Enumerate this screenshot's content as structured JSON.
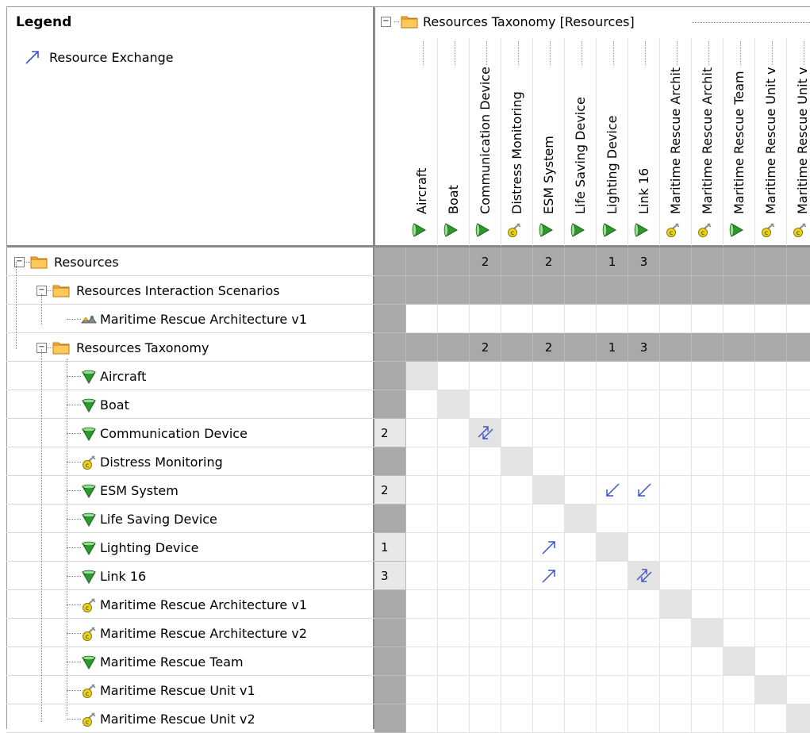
{
  "legend": {
    "title": "Legend",
    "item_label": "Resource Exchange",
    "arrow_color": "#3a55c8"
  },
  "column_group": {
    "label": "Resources Taxonomy [Resources]"
  },
  "columns": [
    {
      "label": "Aircraft",
      "icon": "resource-green-icon"
    },
    {
      "label": "Boat",
      "icon": "resource-green-icon"
    },
    {
      "label": "Communication Device",
      "icon": "resource-green-icon"
    },
    {
      "label": "Distress Monitoring",
      "icon": "capability-icon"
    },
    {
      "label": "ESM System",
      "icon": "resource-green-icon"
    },
    {
      "label": "Life Saving Device",
      "icon": "resource-green-icon"
    },
    {
      "label": "Lighting Device",
      "icon": "resource-green-icon"
    },
    {
      "label": "Link 16",
      "icon": "resource-green-icon"
    },
    {
      "label": "Maritime Rescue Archit",
      "icon": "capability-icon"
    },
    {
      "label": "Maritime Rescue Archit",
      "icon": "capability-icon"
    },
    {
      "label": "Maritime Rescue Team",
      "icon": "resource-green-icon"
    },
    {
      "label": "Maritime Rescue Unit v",
      "icon": "capability-icon"
    },
    {
      "label": "Maritime Rescue Unit v",
      "icon": "capability-icon"
    }
  ],
  "rows": [
    {
      "label": "Resources",
      "icon": "folder-icon",
      "count": ""
    },
    {
      "label": "Resources Interaction Scenarios",
      "icon": "folder-icon",
      "count": ""
    },
    {
      "label": "Maritime Rescue Architecture v1",
      "icon": "architecture-icon",
      "count": ""
    },
    {
      "label": "Resources Taxonomy",
      "icon": "folder-icon",
      "count": ""
    },
    {
      "label": "Aircraft",
      "icon": "resource-green-icon",
      "count": ""
    },
    {
      "label": "Boat",
      "icon": "resource-green-icon",
      "count": ""
    },
    {
      "label": "Communication Device",
      "icon": "resource-green-icon",
      "count": "2"
    },
    {
      "label": "Distress Monitoring",
      "icon": "capability-icon",
      "count": ""
    },
    {
      "label": "ESM System",
      "icon": "resource-green-icon",
      "count": "2"
    },
    {
      "label": "Life Saving Device",
      "icon": "resource-green-icon",
      "count": ""
    },
    {
      "label": "Lighting Device",
      "icon": "resource-green-icon",
      "count": "1"
    },
    {
      "label": "Link 16",
      "icon": "resource-green-icon",
      "count": "3"
    },
    {
      "label": "Maritime Rescue Architecture v1",
      "icon": "capability-icon",
      "count": ""
    },
    {
      "label": "Maritime Rescue Architecture v2",
      "icon": "capability-icon",
      "count": ""
    },
    {
      "label": "Maritime Rescue Team",
      "icon": "resource-green-icon",
      "count": ""
    },
    {
      "label": "Maritime Rescue Unit v1",
      "icon": "capability-icon",
      "count": ""
    },
    {
      "label": "Maritime Rescue Unit v2",
      "icon": "capability-icon",
      "count": ""
    }
  ],
  "group_totals": {
    "resources": [
      "",
      "",
      "2",
      "",
      "2",
      "",
      "1",
      "3",
      "",
      "",
      "",
      "",
      ""
    ],
    "resources_taxonomy": [
      "",
      "",
      "2",
      "",
      "2",
      "",
      "1",
      "3",
      "",
      "",
      "",
      "",
      ""
    ]
  },
  "cells": [
    {
      "row": 6,
      "col": 2,
      "arrow": "bidirectional"
    },
    {
      "row": 8,
      "col": 6,
      "arrow": "down-left"
    },
    {
      "row": 8,
      "col": 7,
      "arrow": "down-left"
    },
    {
      "row": 10,
      "col": 4,
      "arrow": "up-right"
    },
    {
      "row": 11,
      "col": 4,
      "arrow": "up-right"
    },
    {
      "row": 11,
      "col": 7,
      "arrow": "bidirectional"
    }
  ],
  "colors": {
    "group_fill": "#a9a9a9",
    "diagonal_fill": "#e3e3e3",
    "folder": "#f5a623",
    "resource_green": "#2e9a2e",
    "capability_yellow": "#d8c21a"
  }
}
